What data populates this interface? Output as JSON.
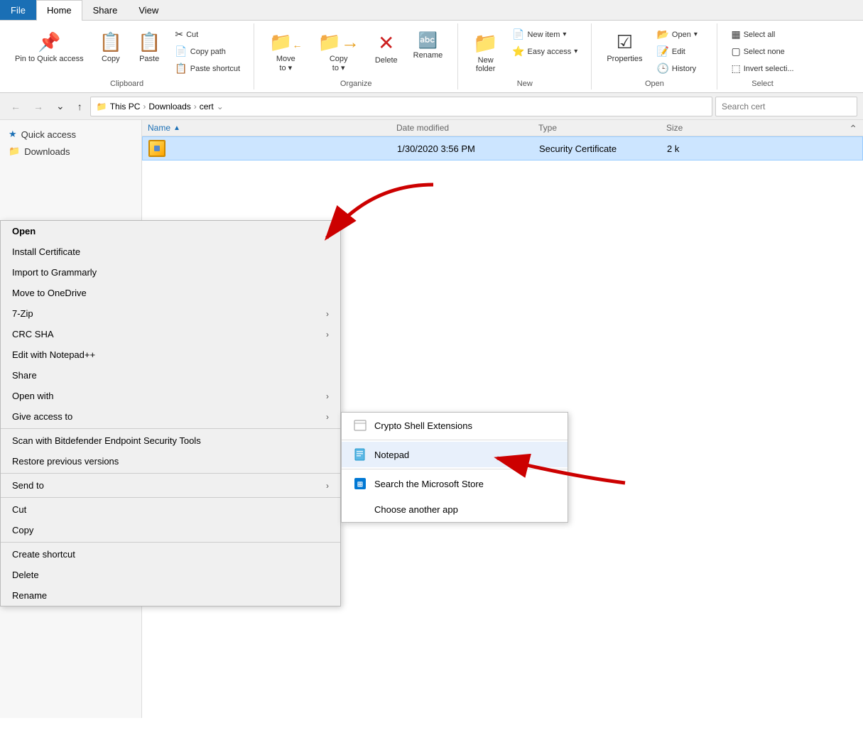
{
  "ribbon": {
    "tabs": [
      {
        "label": "File",
        "active": false,
        "file": true
      },
      {
        "label": "Home",
        "active": true,
        "file": false
      },
      {
        "label": "Share",
        "active": false,
        "file": false
      },
      {
        "label": "View",
        "active": false,
        "file": false
      }
    ],
    "groups": {
      "clipboard": {
        "label": "Clipboard",
        "pin_label": "Pin to Quick\naccess",
        "copy_label": "Copy",
        "paste_label": "Paste",
        "cut_label": "Cut",
        "copy_path_label": "Copy path",
        "paste_shortcut_label": "Paste shortcut"
      },
      "organize": {
        "label": "Organize",
        "move_to_label": "Move\nto",
        "copy_to_label": "Copy\nto",
        "delete_label": "Delete",
        "rename_label": "Rename"
      },
      "new": {
        "label": "New",
        "new_folder_label": "New\nfolder",
        "new_item_label": "New item",
        "easy_access_label": "Easy access"
      },
      "open": {
        "label": "Open",
        "properties_label": "Properties",
        "open_label": "Open",
        "edit_label": "Edit",
        "history_label": "History"
      },
      "select": {
        "label": "Select",
        "select_all_label": "Select all",
        "select_none_label": "Select none",
        "invert_label": "Invert selecti..."
      }
    }
  },
  "navbar": {
    "breadcrumb": "This PC > Downloads > cert",
    "breadcrumb_parts": [
      "This PC",
      "Downloads",
      "cert"
    ],
    "search_placeholder": "Search cert"
  },
  "sidebar": {
    "items": [
      {
        "label": "Quick access",
        "icon": "★",
        "star": true
      },
      {
        "label": "Downloads",
        "icon": "📁",
        "star": false
      }
    ]
  },
  "file_list": {
    "columns": [
      "Name",
      "Date modified",
      "Type",
      "Size"
    ],
    "row": {
      "date": "1/30/2020 3:56 PM",
      "type": "Security Certificate",
      "size": "2 k"
    }
  },
  "context_menu": {
    "items": [
      {
        "label": "Open",
        "bold": true,
        "submenu": false,
        "separator_after": false
      },
      {
        "label": "Install Certificate",
        "bold": false,
        "submenu": false,
        "separator_after": false
      },
      {
        "label": "Import to Grammarly",
        "bold": false,
        "submenu": false,
        "separator_after": false
      },
      {
        "label": "Move to OneDrive",
        "bold": false,
        "submenu": false,
        "separator_after": false
      },
      {
        "label": "7-Zip",
        "bold": false,
        "submenu": true,
        "separator_after": false
      },
      {
        "label": "CRC SHA",
        "bold": false,
        "submenu": true,
        "separator_after": false
      },
      {
        "label": "Edit with Notepad++",
        "bold": false,
        "submenu": false,
        "separator_after": false
      },
      {
        "label": "Share",
        "bold": false,
        "submenu": false,
        "separator_after": false
      },
      {
        "label": "Open with",
        "bold": false,
        "submenu": true,
        "separator_after": false
      },
      {
        "label": "Give access to",
        "bold": false,
        "submenu": true,
        "separator_after": true
      },
      {
        "label": "Scan with Bitdefender Endpoint Security Tools",
        "bold": false,
        "submenu": false,
        "separator_after": false
      },
      {
        "label": "Restore previous versions",
        "bold": false,
        "submenu": false,
        "separator_after": true
      },
      {
        "label": "Send to",
        "bold": false,
        "submenu": true,
        "separator_after": true
      },
      {
        "label": "Cut",
        "bold": false,
        "submenu": false,
        "separator_after": false
      },
      {
        "label": "Copy",
        "bold": false,
        "submenu": false,
        "separator_after": true
      },
      {
        "label": "Create shortcut",
        "bold": false,
        "submenu": false,
        "separator_after": false
      },
      {
        "label": "Delete",
        "bold": false,
        "submenu": false,
        "separator_after": false
      },
      {
        "label": "Rename",
        "bold": false,
        "submenu": false,
        "separator_after": false
      }
    ]
  },
  "submenu": {
    "items": [
      {
        "label": "Crypto Shell Extensions",
        "icon": "doc"
      },
      {
        "label": "Notepad",
        "icon": "notepad"
      },
      {
        "label": "Search the Microsoft Store",
        "icon": "store"
      },
      {
        "label": "Choose another app",
        "icon": "none"
      }
    ],
    "separator_after": 1
  },
  "arrows": {
    "arrow1_desc": "Red arrow pointing to file row from top-right",
    "arrow2_desc": "Red arrow pointing to Notepad submenu item from right"
  }
}
